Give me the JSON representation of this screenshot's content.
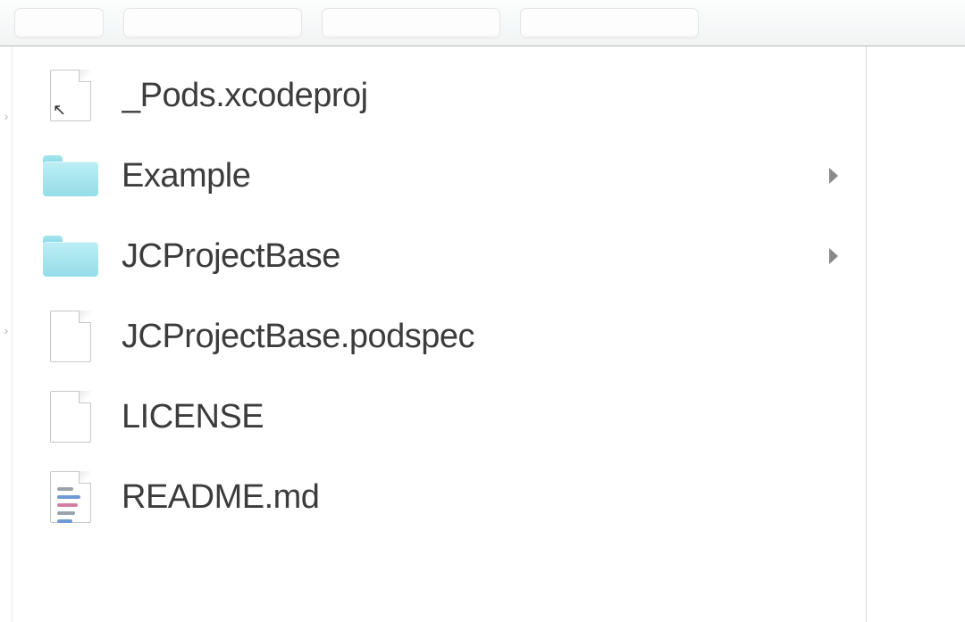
{
  "files": [
    {
      "name": "_Pods.xcodeproj",
      "icon": "file-alias-icon",
      "is_dir": false
    },
    {
      "name": "Example",
      "icon": "folder-icon",
      "is_dir": true
    },
    {
      "name": "JCProjectBase",
      "icon": "folder-icon",
      "is_dir": true
    },
    {
      "name": "JCProjectBase.podspec",
      "icon": "file-icon",
      "is_dir": false
    },
    {
      "name": "LICENSE",
      "icon": "file-icon",
      "is_dir": false
    },
    {
      "name": "README.md",
      "icon": "file-text-icon",
      "is_dir": false
    }
  ]
}
